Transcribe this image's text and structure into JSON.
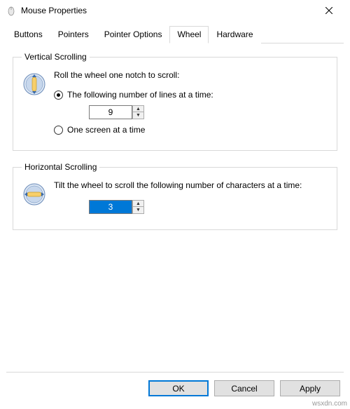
{
  "window": {
    "title": "Mouse Properties"
  },
  "tabs": {
    "items": [
      "Buttons",
      "Pointers",
      "Pointer Options",
      "Wheel",
      "Hardware"
    ],
    "active": "Wheel"
  },
  "vertical": {
    "legend": "Vertical Scrolling",
    "instruction": "Roll the wheel one notch to scroll:",
    "opt_lines": "The following number of lines at a time:",
    "lines_value": "9",
    "opt_screen": "One screen at a time"
  },
  "horizontal": {
    "legend": "Horizontal Scrolling",
    "instruction": "Tilt the wheel to scroll the following number of characters at a time:",
    "chars_value": "3"
  },
  "buttons": {
    "ok": "OK",
    "cancel": "Cancel",
    "apply": "Apply"
  },
  "watermark": "wsxdn.com"
}
